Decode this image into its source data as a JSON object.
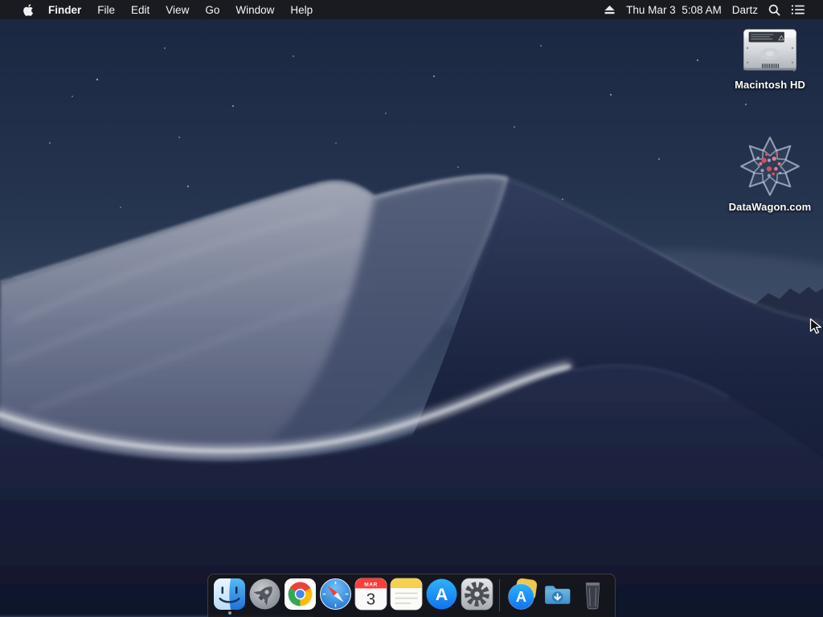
{
  "menu_bar": {
    "app_name": "Finder",
    "menus": [
      "File",
      "Edit",
      "View",
      "Go",
      "Window",
      "Help"
    ],
    "status": {
      "clock": "Thu Mar 3  5:08 AM",
      "user": "Dartz"
    },
    "icons": [
      "apple-logo",
      "eject-icon",
      "search-icon",
      "notification-list-icon"
    ]
  },
  "desktop": {
    "icons": [
      {
        "label": "Macintosh HD",
        "icon": "hard-drive-icon"
      },
      {
        "label": "DataWagon.com",
        "icon": "starburst-webloc-icon"
      }
    ]
  },
  "dock": {
    "items": [
      {
        "name": "Finder",
        "running": true
      },
      {
        "name": "Launchpad",
        "running": false
      },
      {
        "name": "Google Chrome",
        "running": false
      },
      {
        "name": "Safari",
        "running": false
      },
      {
        "name": "Calendar",
        "running": false,
        "month": "MAR",
        "day": "3"
      },
      {
        "name": "Notes",
        "running": false
      },
      {
        "name": "App Store",
        "running": false,
        "glyph": "A"
      },
      {
        "name": "System Preferences",
        "running": false
      },
      {
        "name": "Applications Stack",
        "running": false,
        "glyph": "A"
      },
      {
        "name": "Downloads",
        "running": false
      },
      {
        "name": "Trash",
        "running": false
      }
    ]
  },
  "colors": {
    "menu_bar_bg": "#1a1b1f",
    "dock_bg": "rgba(23,23,26,0.78)",
    "sky_top": "#1a2640",
    "sky_horizon": "#515e7a",
    "dune_lit": "#a3a8b6",
    "dune_dark": "#10162b",
    "finder_blue": "#2478d4",
    "calendar_red": "#fc3d39",
    "appstore_blue": "#1f8ef5",
    "downloads_folder_blue": "#57a8dc"
  }
}
